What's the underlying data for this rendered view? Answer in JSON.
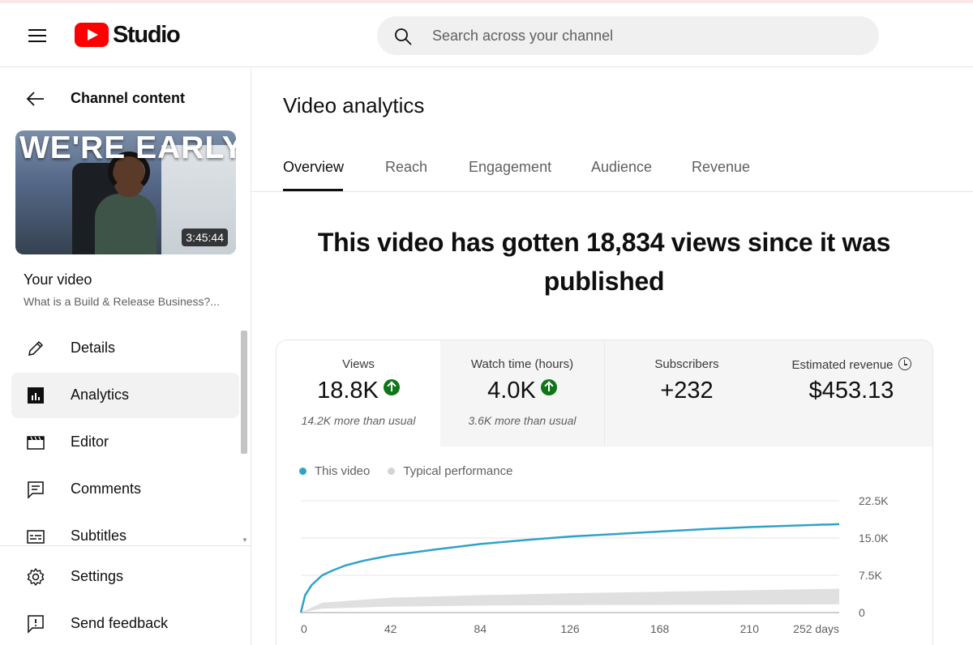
{
  "app": {
    "logo_text": "Studio",
    "search_placeholder": "Search across your channel"
  },
  "sidebar": {
    "back_label": "Channel content",
    "thumbnail": {
      "title_text": "WE'RE EARLY",
      "duration": "3:45:44"
    },
    "video_heading": "Your video",
    "video_title": "What is a Build & Release Business?...",
    "items": [
      {
        "label": "Details",
        "icon": "pencil-icon",
        "active": false
      },
      {
        "label": "Analytics",
        "icon": "analytics-icon",
        "active": true
      },
      {
        "label": "Editor",
        "icon": "clapper-icon",
        "active": false
      },
      {
        "label": "Comments",
        "icon": "comment-icon",
        "active": false
      },
      {
        "label": "Subtitles",
        "icon": "subtitles-icon",
        "active": false
      }
    ],
    "bottom": [
      {
        "label": "Settings",
        "icon": "gear-icon"
      },
      {
        "label": "Send feedback",
        "icon": "feedback-icon"
      }
    ]
  },
  "main": {
    "title": "Video analytics",
    "tabs": [
      {
        "label": "Overview",
        "active": true
      },
      {
        "label": "Reach"
      },
      {
        "label": "Engagement"
      },
      {
        "label": "Audience"
      },
      {
        "label": "Revenue"
      }
    ],
    "headline": "This video has gotten 18,834 views since it was published",
    "metrics": [
      {
        "label": "Views",
        "value": "18.8K",
        "trend": "up",
        "note": "14.2K more than usual"
      },
      {
        "label": "Watch time (hours)",
        "value": "4.0K",
        "trend": "up",
        "note": "3.6K more than usual"
      },
      {
        "label": "Subscribers",
        "value": "+232",
        "note": ""
      },
      {
        "label": "Estimated revenue",
        "value": "$453.13",
        "note": ""
      }
    ],
    "legend": [
      {
        "label": "This video",
        "color": "#2fa2c9"
      },
      {
        "label": "Typical performance",
        "color": "#d4d4d4"
      }
    ]
  },
  "chart_data": {
    "type": "line",
    "x_tick_labels": [
      "0",
      "42",
      "84",
      "126",
      "168",
      "210",
      "252 days"
    ],
    "y_tick_labels": [
      "22.5K",
      "15.0K",
      "7.5K",
      "0"
    ],
    "xlim": [
      0,
      252
    ],
    "ylim": [
      0,
      22500
    ],
    "grid": true,
    "legend_position": "top-left",
    "series": [
      {
        "name": "This video",
        "color": "#2fa2c9",
        "x": [
          0,
          2,
          5,
          10,
          15,
          21,
          30,
          42,
          63,
          84,
          105,
          126,
          147,
          168,
          189,
          210,
          231,
          252
        ],
        "y": [
          0,
          3500,
          5500,
          7500,
          8500,
          9500,
          10500,
          11500,
          12700,
          13800,
          14600,
          15300,
          15800,
          16300,
          16800,
          17200,
          17500,
          17800
        ]
      },
      {
        "name": "Typical performance",
        "type": "area",
        "color": "#e0e0e0",
        "x": [
          0,
          10,
          42,
          84,
          126,
          168,
          210,
          252
        ],
        "low": [
          0,
          800,
          1200,
          1400,
          1500,
          1550,
          1600,
          1650
        ],
        "high": [
          0,
          2000,
          3000,
          3500,
          3900,
          4200,
          4500,
          4800
        ]
      }
    ]
  }
}
